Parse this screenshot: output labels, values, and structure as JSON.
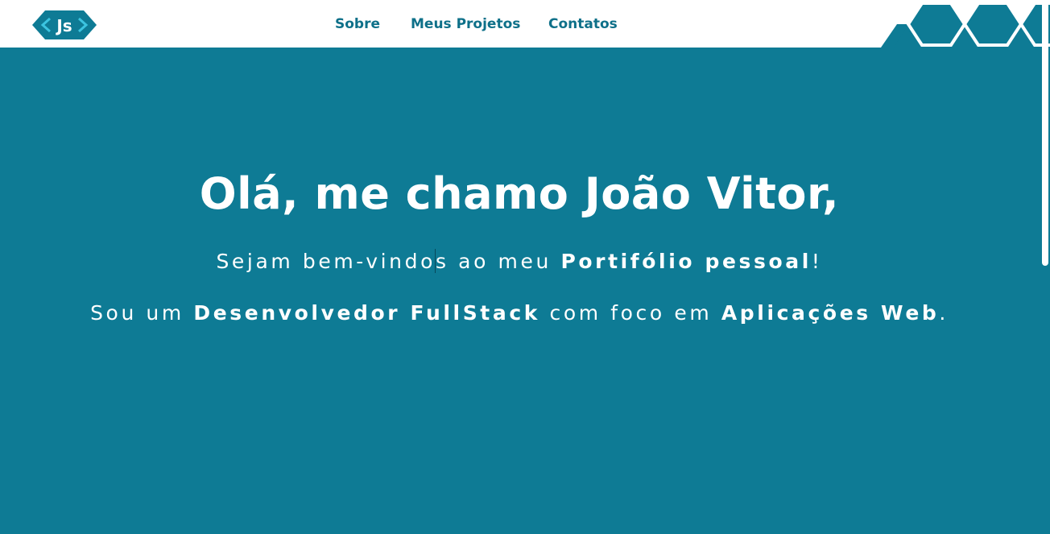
{
  "header": {
    "logo": {
      "text": "Js",
      "icon": "js-code-brackets-logo"
    },
    "nav": [
      {
        "label": "Sobre"
      },
      {
        "label": "Meus Projetos"
      },
      {
        "label": "Contatos"
      }
    ]
  },
  "hero": {
    "title": "Olá, me chamo João Vitor,",
    "line1": {
      "part1": "Sejam bem-vindo",
      "part2": "s ao meu ",
      "bold": "Portifólio pessoal",
      "end": "!"
    },
    "line2": {
      "part1": "Sou um ",
      "bold1": "Desenvolvedor FullStack",
      "part2": " com foco em ",
      "bold2": "Aplicações Web",
      "end": "."
    }
  },
  "colors": {
    "primary": "#0e7b95",
    "nav_text": "#0e7089",
    "white": "#ffffff"
  }
}
